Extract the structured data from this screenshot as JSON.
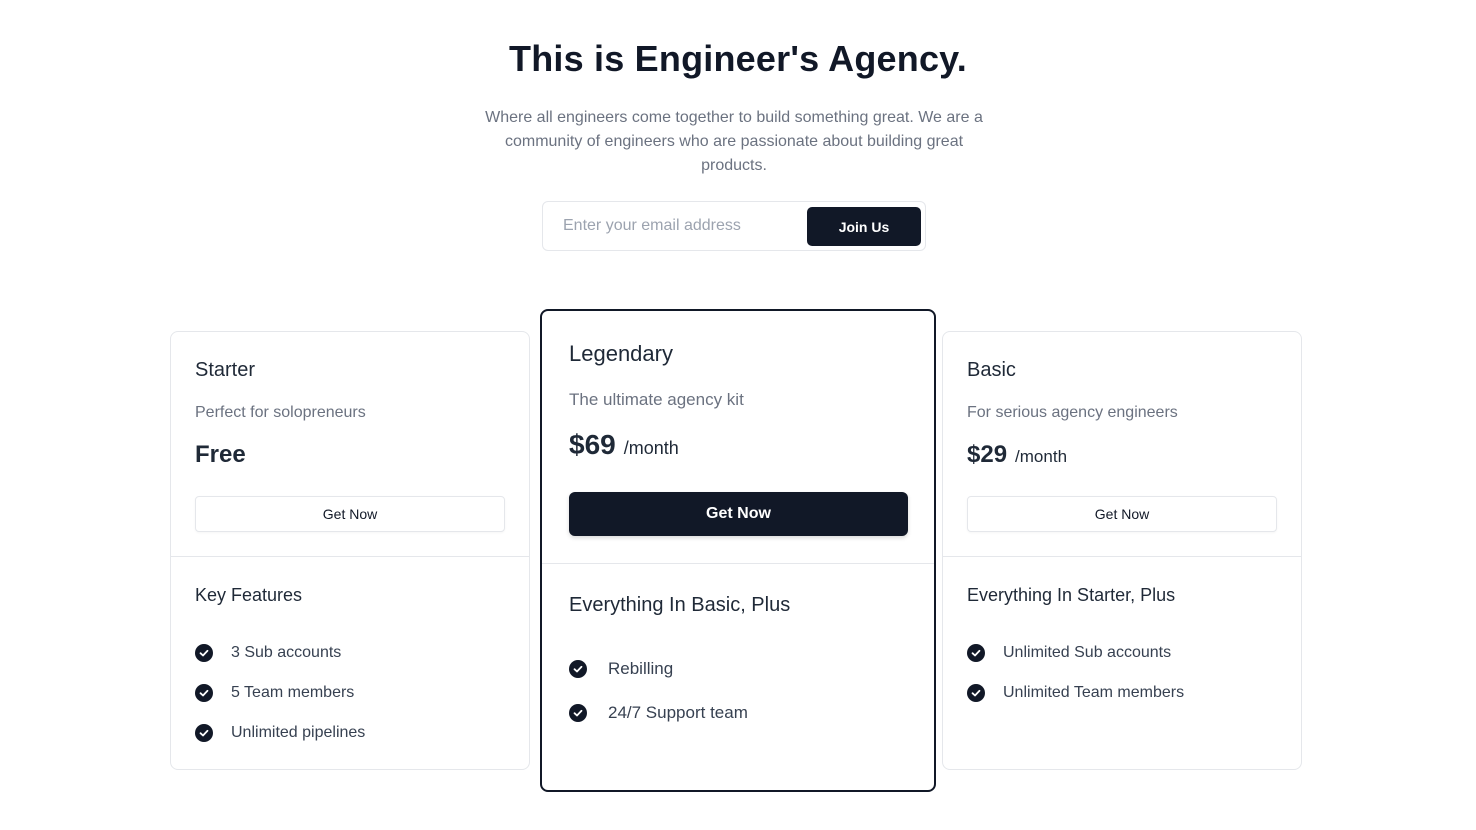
{
  "hero": {
    "title": "This is Engineer's Agency.",
    "description": "Where all engineers come together to build something great. We are a community of engineers who are passionate about building great products."
  },
  "signup": {
    "email_placeholder": "Enter your email address",
    "email_value": "",
    "join_label": "Join Us"
  },
  "plans": [
    {
      "name": "Starter",
      "description": "Perfect for solopreneurs",
      "price": "Free",
      "period": "",
      "cta": "Get Now",
      "features_title": "Key Features",
      "features": [
        "3 Sub accounts",
        "5 Team members",
        "Unlimited pipelines"
      ]
    },
    {
      "name": "Legendary",
      "description": "The ultimate agency kit",
      "price": "$69",
      "period": "/month",
      "cta": "Get Now",
      "features_title": "Everything In Basic, Plus",
      "features": [
        "Rebilling",
        "24/7 Support team"
      ]
    },
    {
      "name": "Basic",
      "description": "For serious agency engineers",
      "price": "$29",
      "period": "/month",
      "cta": "Get Now",
      "features_title": "Everything In Starter, Plus",
      "features": [
        "Unlimited Sub accounts",
        "Unlimited Team members"
      ]
    }
  ],
  "colors": {
    "primary": "#111827",
    "muted_text": "#6b7280",
    "border": "#e5e7eb"
  },
  "icons": {
    "feature_check": "check-circle-icon"
  }
}
